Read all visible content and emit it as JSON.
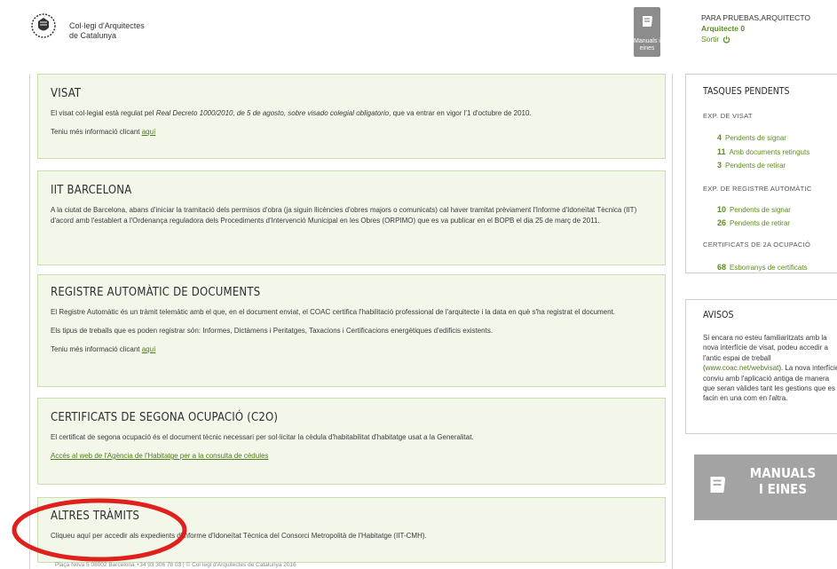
{
  "header": {
    "brand_line1": "Col·legi d'Arquitectes",
    "brand_line2": "de Catalunya",
    "manuals_tile_label": "Manuals i eines",
    "user_name": "PARA PRUEBAS,ARQUITECTO",
    "user_role": "Arquitecte 0",
    "logout_label": "Sortir"
  },
  "panels": {
    "visat": {
      "title": "VISAT",
      "text_before": "El visat col·legial està regulat pel ",
      "text_italic": "Real Decreto 1000/2010, de 5 de agosto, sobre visado colegial obligatorio",
      "text_after": ", que va entrar en vigor l'1 d'octubre de 2010.",
      "more_prefix": "Teniu més informació clicant ",
      "more_link": "aquí"
    },
    "iit": {
      "title": "IIT BARCELONA",
      "text": "A la ciutat de Barcelona, abans d'iniciar la tramitació dels permisos d'obra (ja siguin llicències d'obres majors o comunicats) cal haver tramitat prèviament l'Informe d'Idoneïtat Tècnica (IIT) d'acord amb l'establert a l'Ordenança reguladora dels Procediments d'Intervenció Municipal en les Obres (ORPIMO) que es va publicar en el BOPB el dia 25 de març de 2011."
    },
    "registre": {
      "title": "REGISTRE AUTOMÀTIC DE DOCUMENTS",
      "text1": "El Registre Automàtic és un tràmit telemàtic amb el que, en el document enviat, el COAC certifica l'habilitació professional de l'arquitecte i la data en què s'ha registrat el document.",
      "text2": "Els tipus de treballs que es poden registrar són: Informes, Dictàmens i Peritatges, Taxacions i Certificacions energètiques d'edificis existents.",
      "more_prefix": "Teniu més informació clicant ",
      "more_link": "aquí"
    },
    "c2o": {
      "title": "CERTIFICATS DE SEGONA OCUPACIÓ (C2O)",
      "text": "El certificat de segona ocupació és el document tècnic necessari per sol·licitar la cèdula d'habitabilitat d'habitatge usat a la Generalitat.",
      "link": "Accés al web de l'Agència de l'Habitatge per a la consulta de cèdules"
    },
    "altres": {
      "title": "ALTRES TRÀMITS",
      "text": "Cliqueu aquí per accedir als expedients d'Informe d'Idoneïtat Tècnica del Consorci Metropolità de l'Habitatge (IIT-CMH)."
    }
  },
  "sidebar": {
    "tasks_title": "TASQUES PENDENTS",
    "visat_sub": "EXP. DE VISAT",
    "visat_tasks": [
      {
        "count": "4",
        "label": "Pendents de signar"
      },
      {
        "count": "11",
        "label": "Amb documents retinguts"
      },
      {
        "count": "3",
        "label": "Pendents de retirar"
      }
    ],
    "registre_sub": "EXP. DE REGISTRE AUTOMÀTIC",
    "registre_tasks": [
      {
        "count": "10",
        "label": "Pendents de signar"
      },
      {
        "count": "26",
        "label": "Pendents de retirar"
      }
    ],
    "cert_sub": "CERTIFICATS DE 2A OCUPACIÓ",
    "cert_tasks": [
      {
        "count": "68",
        "label": "Esborranys de certificats"
      }
    ],
    "avisos_title": "AVISOS",
    "avisos_before": "Si encara no esteu familiaritzats amb la nova interfície de visat, podeu accedir a l'antic espai de treball (",
    "avisos_link": "www.coac.net/webvisat",
    "avisos_after": "). La nova interfície conviu amb l'aplicació antiga de manera que seran vàlides tant les gestions que es facin en una com en l'altra.",
    "manuals_big_line1": "MANUALS",
    "manuals_big_line2": "I EINES"
  },
  "footer": {
    "text": "Plaça Nova 5 08002 Barcelona +34 93 306 78 03  |  © Col·legi d'Arquitectes de Catalunya 2016"
  },
  "icons": {
    "logo": "coac-shield-logo",
    "manuals": "book-icon",
    "logout": "power-icon"
  },
  "colors": {
    "accent_green": "#5c8d1c",
    "panel_bg": "#f2f7ea",
    "panel_border": "#c8e0ae",
    "manuals_tile": "#8c8c8c",
    "annotation_red": "#e0201c"
  }
}
